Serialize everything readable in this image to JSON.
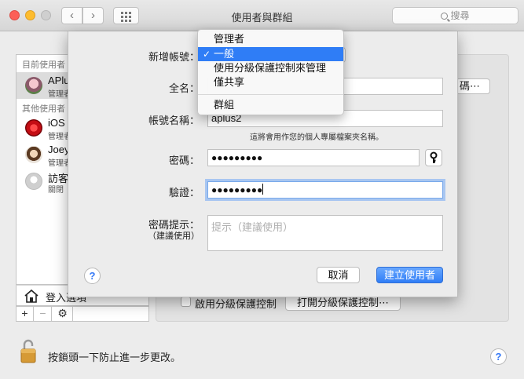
{
  "window": {
    "title": "使用者與群組"
  },
  "toolbar": {
    "back": "‹",
    "forward": "›",
    "search_placeholder": "搜尋"
  },
  "sidebar": {
    "current_header": "目前使用者",
    "other_header": "其他使用者",
    "users": [
      {
        "name": "APlus",
        "role": "管理者",
        "selected": true
      },
      {
        "name": "iOS",
        "role": "管理者"
      },
      {
        "name": "Joey",
        "role": "管理者"
      },
      {
        "name": "訪客",
        "role": "關閉"
      }
    ],
    "login_options": "登入選項",
    "tools": {
      "add": "+",
      "remove": "−",
      "gear": "⚙"
    }
  },
  "rightpane": {
    "parental_checkbox_label": "啟用分級保護控制",
    "parental_button": "打開分級保護控制⋯",
    "stub_button": "碼⋯"
  },
  "sheet": {
    "new_account_label": "新增帳號：",
    "full_name_label": "全名：",
    "account_name_label": "帳號名稱：",
    "account_name_value": "aplus2",
    "account_hint": "這將會用作您的個人專屬檔案夾名稱。",
    "password_label": "密碼：",
    "password_value": "●●●●●●●●●",
    "verify_label": "驗證：",
    "verify_value": "●●●●●●●●●",
    "hint_label": "密碼提示：",
    "hint_sub_label": "（建議使用）",
    "hint_placeholder": "提示（建議使用）",
    "help": "?",
    "cancel": "取消",
    "create": "建立使用者"
  },
  "menu": {
    "items": [
      {
        "label": "管理者",
        "selected": false
      },
      {
        "label": "一般",
        "selected": true
      },
      {
        "label": "使用分級保護控制來管理",
        "selected": false
      },
      {
        "label": "僅共享",
        "selected": false
      },
      {
        "label": "群組",
        "selected": false
      }
    ],
    "check": "✓"
  },
  "footer": {
    "lock_text": "按鎖頭一下防止進一步更改。",
    "help": "?"
  },
  "colors": {
    "accent": "#2f7df6",
    "close": "#fc5f57",
    "minimize": "#fdbc2e"
  }
}
